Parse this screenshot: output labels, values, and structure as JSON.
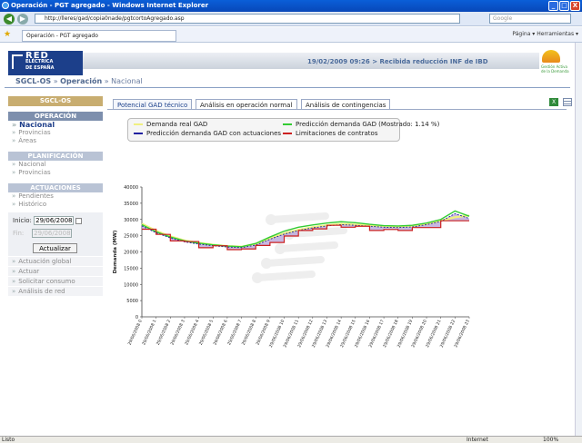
{
  "window": {
    "title": "Operación - PGT agregado - Windows Internet Explorer",
    "buttons": {
      "min": "_",
      "max": "□",
      "close": "X"
    }
  },
  "browser": {
    "url": "http://lleres/gad/copia0nade/pgtcortoAgregado.asp",
    "search_placeholder": "Google",
    "tab_title": "Operación - PGT agregado",
    "tools": "Página ▾  Herramientas ▾",
    "status": "Listo",
    "zone": "Internet",
    "zoom": "100%"
  },
  "header": {
    "logo_line1": "RED",
    "logo_line2": "ELÉCTRICA",
    "logo_line3": "DE ESPAÑA",
    "info": "19/02/2009 09:26 > Recibida reducción INF de IBD",
    "bull_text": "Gestión Activa de la Demanda"
  },
  "breadcrumb": {
    "root": "SGCL-OS",
    "sep1": " » ",
    "level1": "Operación",
    "sep2": " » ",
    "level2": "Nacional"
  },
  "sidebar": {
    "title": "SGCL-OS",
    "operacion": {
      "title": "OPERACIÓN",
      "items": [
        "Nacional",
        "Provincias",
        "Áreas"
      ]
    },
    "planificacion": {
      "title": "PLANIFICACIÓN",
      "items": [
        "Nacional",
        "Provincias"
      ]
    },
    "actuaciones": {
      "title": "ACTUACIONES",
      "items": [
        "Pendientes",
        "Histórico"
      ]
    },
    "inicio_label": "Inicio:",
    "inicio_value": "29/06/2008",
    "fin_label": "Fin:",
    "fin_value": "29/06/2008",
    "update_button": "Actualizar",
    "actions": [
      "Actuación global",
      "Actuar",
      "Solicitar consumo",
      "Análisis de red"
    ]
  },
  "tabs": [
    "Potencial GAD técnico",
    "Análisis en operación normal",
    "Análisis de contingencias"
  ],
  "legend": {
    "demanda_real": "Demanda real GAD",
    "prediccion": "Predicción demanda GAD (Mostrado: 1.14 %)",
    "prediccion_act": "Predicción demanda GAD con actuaciones",
    "limitaciones": "Limitaciones de contratos"
  },
  "colors": {
    "demanda_real": "#f0f080",
    "prediccion": "#33cc33",
    "prediccion_act": "#2020a0",
    "limitaciones": "#cc2020",
    "fill": "#b49fd8"
  },
  "chart_data": {
    "type": "line",
    "ylabel": "Demanda (MW)",
    "ylim": [
      0,
      40000
    ],
    "yticks": [
      0,
      5000,
      10000,
      15000,
      20000,
      25000,
      30000,
      35000,
      40000
    ],
    "categories": [
      "29/06/2008 0",
      "29/06/2008 1",
      "29/06/2008 2",
      "29/06/2008 3",
      "29/06/2008 4",
      "29/06/2008 5",
      "29/06/2008 6",
      "29/06/2008 7",
      "29/06/2008 8",
      "29/06/2008 9",
      "29/06/2008 10",
      "29/06/2008 11",
      "29/06/2008 12",
      "29/06/2008 13",
      "29/06/2008 14",
      "29/06/2008 15",
      "29/06/2008 16",
      "29/06/2008 17",
      "29/06/2008 18",
      "29/06/2008 19",
      "29/06/2008 20",
      "29/06/2008 21",
      "29/06/2008 22",
      "29/06/2008 23"
    ],
    "series": [
      {
        "name": "Demanda real GAD",
        "values": [
          28700,
          26500,
          24800,
          23500,
          22800,
          22200,
          21800,
          21600,
          22500,
          24200,
          25700,
          26800,
          27600,
          28200,
          28600,
          28400,
          28100,
          27900,
          27800,
          28000,
          28600,
          29600,
          30700,
          31200
        ]
      },
      {
        "name": "Predicción demanda GAD (Mostrado: 1.14 %)",
        "values": [
          28400,
          26200,
          24600,
          23400,
          22700,
          22200,
          21800,
          21600,
          22600,
          24600,
          26400,
          27600,
          28300,
          28900,
          29300,
          29000,
          28500,
          28100,
          28000,
          28200,
          28900,
          30000,
          32600,
          31000
        ]
      },
      {
        "name": "Predicción demanda GAD con actuaciones",
        "values": [
          28000,
          25900,
          24300,
          23100,
          22400,
          21900,
          21500,
          21300,
          22100,
          23900,
          25500,
          26600,
          27400,
          28000,
          28400,
          28200,
          27900,
          27600,
          27500,
          27700,
          28400,
          29400,
          31800,
          30300
        ]
      },
      {
        "name": "Limitaciones de contratos",
        "values": [
          27000,
          25400,
          23400,
          23200,
          21300,
          21900,
          20700,
          20900,
          22000,
          22900,
          24900,
          26600,
          27100,
          28200,
          27600,
          27900,
          26600,
          26900,
          26600,
          27500,
          27500,
          29600,
          29600,
          29600
        ]
      }
    ]
  }
}
